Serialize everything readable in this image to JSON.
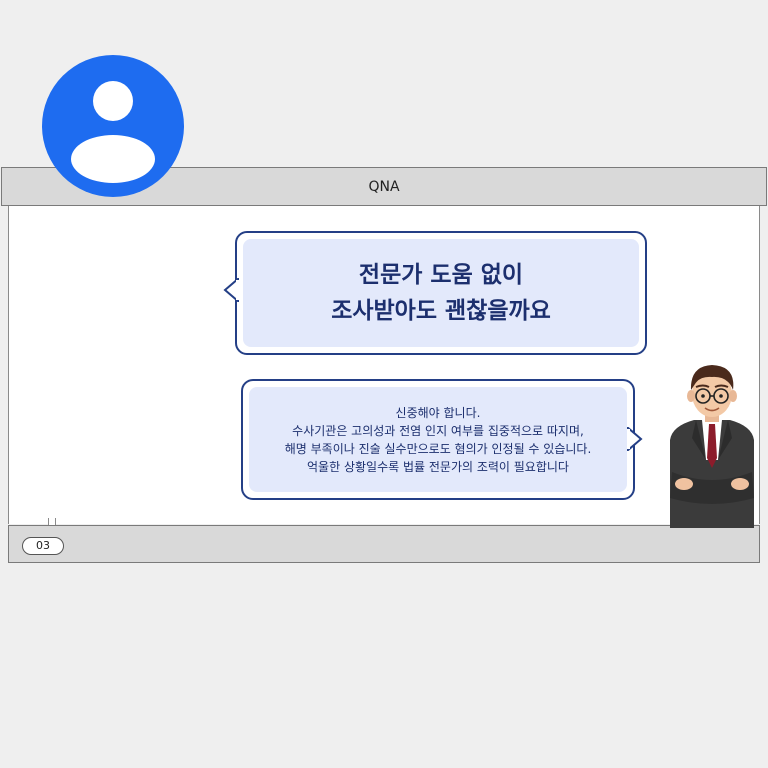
{
  "header": {
    "title": "QNA"
  },
  "footer": {
    "page_number": "03"
  },
  "question": {
    "line1": "전문가 도움 없이",
    "line2": "조사받아도 괜찮을까요"
  },
  "answer": {
    "lines": [
      "신중해야 합니다.",
      "수사기관은 고의성과 전염 인지 여부를 집중적으로 따지며,",
      "해명 부족이나 진술 실수만으로도 혐의가 인정될 수 있습니다.",
      "억울한 상황일수록 법률 전문가의 조력이 필요합니다"
    ]
  },
  "colors": {
    "avatar_blue": "#1e6cf0",
    "bubble_border": "#243f86",
    "bubble_fill": "#e3e9fb"
  },
  "icons": {
    "avatar": "user-avatar-icon",
    "person": "lawyer-illustration"
  }
}
